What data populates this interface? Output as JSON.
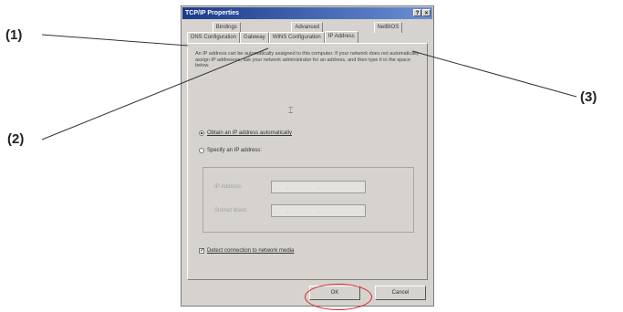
{
  "callouts": {
    "one": "(1)",
    "two": "(2)",
    "three": "(3)"
  },
  "dialog": {
    "title": "TCP/IP Properties",
    "title_buttons": {
      "help": "?",
      "close": "×"
    },
    "tabs_back": [
      "Bindings",
      "Advanced",
      "NetBIOS"
    ],
    "tabs_front": [
      "DNS Configuration",
      "Gateway",
      "WINS Configuration",
      "IP Address"
    ],
    "active_tab": "IP Address",
    "description": "An IP address can be automatically assigned to this computer. If your network does not automatically assign IP addresses, ask your network administrator for an address, and then type it in the space below.",
    "options": {
      "obtain_auto": "Obtain an IP address automatically",
      "specify": "Specify an IP address:"
    },
    "fields": {
      "ip_label": "IP Address:",
      "subnet_label": "Subnet Mask:",
      "dot": "."
    },
    "media_check": "Detect connection to network media",
    "ok_label": "OK",
    "cancel_label": "Cancel"
  },
  "colors": {
    "highlight": "#d0282c",
    "titlebar": "#1b3a8c"
  }
}
